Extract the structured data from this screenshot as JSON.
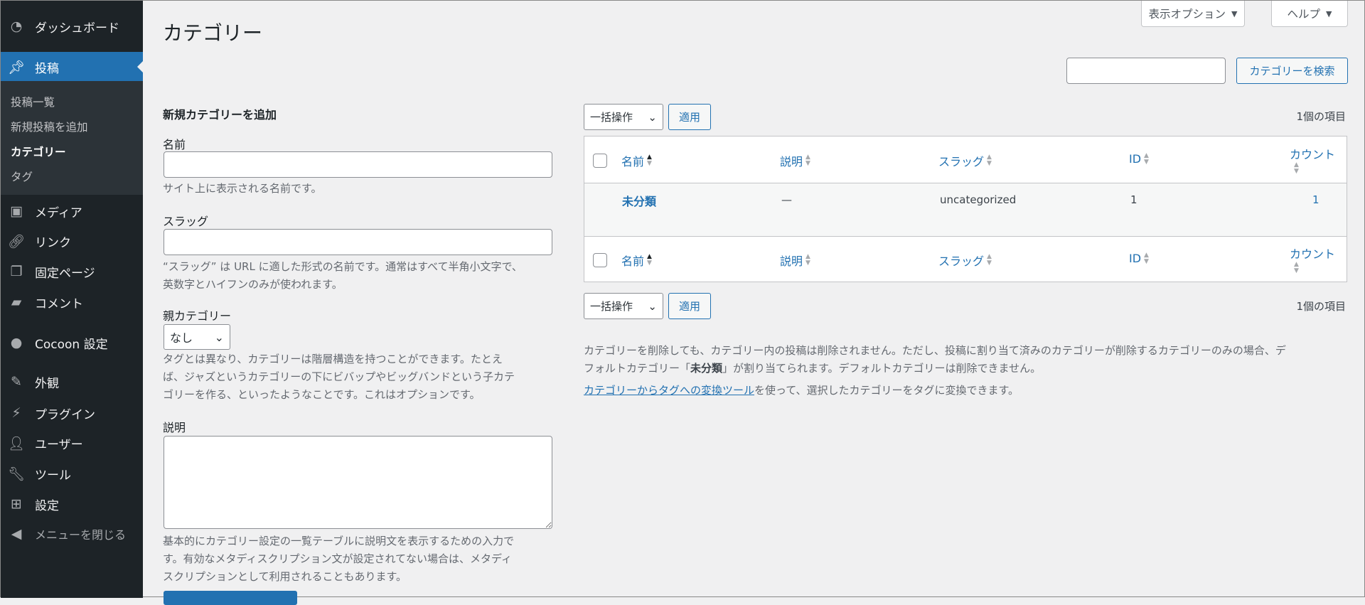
{
  "sidebar": {
    "items": [
      {
        "label": "ダッシュボード",
        "icon": "dashboard-icon"
      },
      {
        "label": "投稿",
        "icon": "pin-icon",
        "active": true
      },
      {
        "label": "メディア",
        "icon": "media-icon"
      },
      {
        "label": "リンク",
        "icon": "link-icon"
      },
      {
        "label": "固定ページ",
        "icon": "pages-icon"
      },
      {
        "label": "コメント",
        "icon": "comment-icon"
      },
      {
        "label": "Cocoon 設定",
        "icon": "cocoon-icon"
      },
      {
        "label": "外観",
        "icon": "appearance-icon"
      },
      {
        "label": "プラグイン",
        "icon": "plugin-icon"
      },
      {
        "label": "ユーザー",
        "icon": "user-icon"
      },
      {
        "label": "ツール",
        "icon": "tools-icon"
      },
      {
        "label": "設定",
        "icon": "settings-icon"
      },
      {
        "label": "メニューを閉じる",
        "icon": "collapse-icon"
      }
    ],
    "submenu": [
      "投稿一覧",
      "新規投稿を追加",
      "カテゴリー",
      "タグ"
    ],
    "accent": "#2271b1"
  },
  "header": {
    "title": "カテゴリー",
    "screen_options": "表示オプション",
    "help": "ヘルプ"
  },
  "search": {
    "value": "",
    "button": "カテゴリーを検索"
  },
  "form": {
    "heading": "新規カテゴリーを追加",
    "name_label": "名前",
    "name_value": "",
    "name_help": "サイト上に表示される名前です。",
    "slug_label": "スラッグ",
    "slug_value": "",
    "slug_help1": "“スラッグ” は URL に適した形式の名前です。通常はすべて半角小文字で、",
    "slug_help2": "英数字とハイフンのみが使われます。",
    "parent_label": "親カテゴリー",
    "parent_value": "なし",
    "parent_help1": "タグとは異なり、カテゴリーは階層構造を持つことができます。たとえ",
    "parent_help2": "ば、ジャズというカテゴリーの下にビバップやビッグバンドという子カテ",
    "parent_help3": "ゴリーを作る、といったようなことです。これはオプションです。",
    "desc_label": "説明",
    "desc_value": "",
    "desc_help1": "基本的にカテゴリー設定の一覧テーブルに説明文を表示するための入力で",
    "desc_help2": "す。有効なメタディスクリプション文が設定されてない場合は、メタディ",
    "desc_help3": "スクリプションとして利用されることもあります。"
  },
  "list": {
    "bulk": "一括操作",
    "apply": "適用",
    "count": "1個の項目",
    "columns": [
      "名前",
      "説明",
      "スラッグ",
      "ID",
      "カウント"
    ],
    "rows": [
      {
        "name": "未分類",
        "description": "—",
        "slug": "uncategorized",
        "id": "1",
        "count": "1"
      }
    ],
    "note1": "カテゴリーを削除しても、カテゴリー内の投稿は削除されません。ただし、投稿に割り当て済みのカテゴリーが削除するカテゴリーのみの場合、デ",
    "note2a": "フォルトカテゴリー「",
    "note2b": "未分類",
    "note2c": "」が割り当てられます。デフォルトカテゴリーは削除できません。",
    "note3_link": "カテゴリーからタグへの変換ツール",
    "note3_rest": "を使って、選択したカテゴリーをタグに変換できます。"
  }
}
